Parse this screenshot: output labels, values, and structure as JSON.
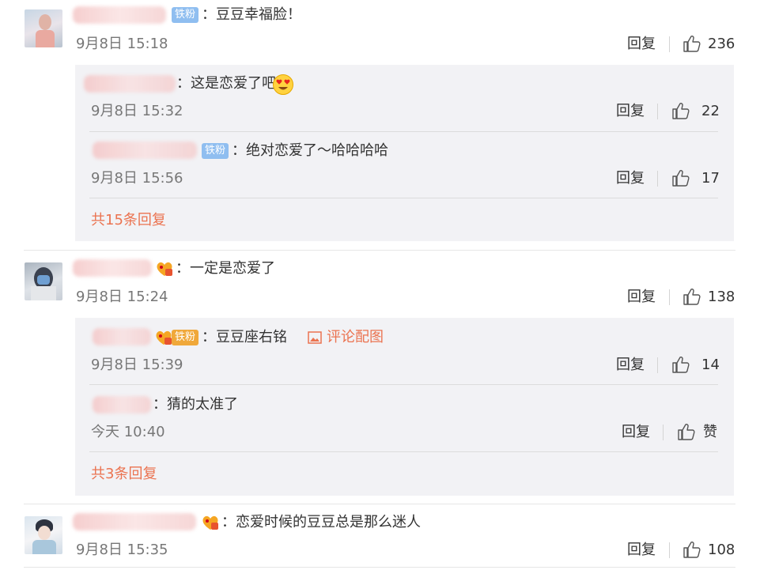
{
  "comments": [
    {
      "badge": "铁粉",
      "text": "：豆豆幸福脸！",
      "time": "9月8日 15:18",
      "reply_label": "回复",
      "likes": "236",
      "replies": [
        {
          "text": "：这是恋爱了吧",
          "emoji": "heart-eyes-emoji",
          "time": "9月8日 15:32",
          "reply_label": "回复",
          "likes": "22"
        },
        {
          "badge": "铁粉",
          "text": "：绝对恋爱了～哈哈哈哈",
          "time": "9月8日 15:56",
          "reply_label": "回复",
          "likes": "17"
        }
      ],
      "more_replies": "共15条回复"
    },
    {
      "text": "：一定是恋爱了",
      "time": "9月8日 15:24",
      "reply_label": "回复",
      "likes": "138",
      "replies": [
        {
          "badge": "铁粉",
          "text": "：豆豆座右铭",
          "image_link": "评论配图",
          "time": "9月8日 15:39",
          "reply_label": "回复",
          "likes": "14"
        },
        {
          "text": "：猜的太准了",
          "time": "今天 10:40",
          "reply_label": "回复",
          "likes": "赞"
        }
      ],
      "more_replies": "共3条回复"
    },
    {
      "text": "：恋爱时候的豆豆总是那么迷人",
      "time": "9月8日 15:35",
      "reply_label": "回复",
      "likes": "108"
    }
  ],
  "colors": {
    "accent": "#eb7350",
    "fan_badge": "#8fbef0",
    "reply_bg": "#f2f2f5",
    "vip": "#f5a623"
  }
}
